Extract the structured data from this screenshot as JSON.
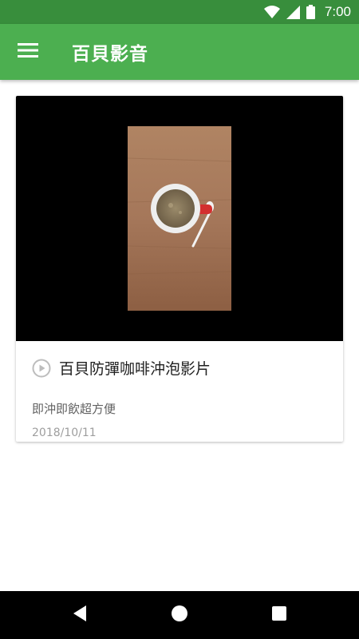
{
  "status_bar": {
    "time": "7:00",
    "icons": [
      "wifi-icon",
      "cellular-signal-icon",
      "battery-icon"
    ]
  },
  "app_bar": {
    "title": "百貝影音",
    "menu_icon": "hamburger-menu-icon",
    "color": "#4caf50"
  },
  "video_card": {
    "title": "百貝防彈咖啡沖泡影片",
    "subtitle": "即沖即飲超方便",
    "date": "2018/10/11",
    "play_icon": "play-circle-icon"
  },
  "nav_bar": {
    "buttons": [
      "back-icon",
      "home-icon",
      "recents-icon"
    ]
  }
}
